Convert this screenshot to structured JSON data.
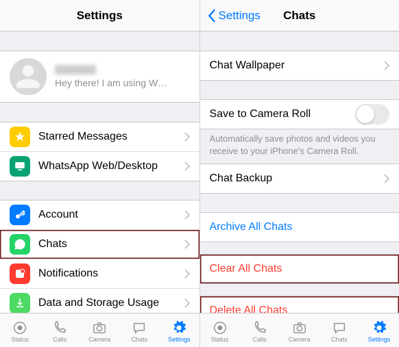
{
  "left": {
    "title": "Settings",
    "profile_status": "Hey there! I am using W…",
    "rows": {
      "starred": "Starred Messages",
      "web": "WhatsApp Web/Desktop",
      "account": "Account",
      "chats": "Chats",
      "notifications": "Notifications",
      "data": "Data and Storage Usage"
    }
  },
  "right": {
    "back": "Settings",
    "title": "Chats",
    "wallpaper": "Chat Wallpaper",
    "camera_roll": "Save to Camera Roll",
    "camera_roll_note": "Automatically save photos and videos you receive to your iPhone's Camera Roll.",
    "backup": "Chat Backup",
    "archive": "Archive All Chats",
    "clear": "Clear All Chats",
    "delete": "Delete All Chats"
  },
  "tabs": {
    "status": "Status",
    "calls": "Calls",
    "camera": "Camera",
    "chats": "Chats",
    "settings": "Settings"
  }
}
